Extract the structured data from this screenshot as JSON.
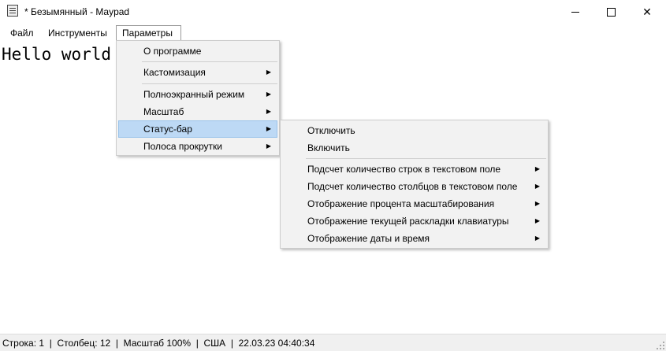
{
  "window": {
    "title": "* Безымянный - Maypad",
    "app_icon": "notepad-icon",
    "controls": [
      "minimize-icon",
      "maximize-icon",
      "close-icon"
    ]
  },
  "menubar": {
    "items": [
      {
        "label": "Файл"
      },
      {
        "label": "Инструменты"
      },
      {
        "label": "Параметры"
      }
    ]
  },
  "editor": {
    "content": "Hello world"
  },
  "params_menu": {
    "items": [
      {
        "label": "О программе"
      },
      {
        "label": "Кастомизация"
      },
      {
        "label": "Полноэкранный режим"
      },
      {
        "label": "Масштаб"
      },
      {
        "label": "Статус-бар"
      },
      {
        "label": "Полоса прокрутки"
      }
    ]
  },
  "statusbar_menu": {
    "items": [
      {
        "label": "Отключить"
      },
      {
        "label": "Включить"
      },
      {
        "label": "Подсчет количество строк в текстовом поле"
      },
      {
        "label": "Подсчет количество столбцов в текстовом поле"
      },
      {
        "label": "Отображение процента масштабирования"
      },
      {
        "label": "Отображение текущей раскладки клавиатуры"
      },
      {
        "label": "Отображение даты и время"
      }
    ]
  },
  "statusbar": {
    "text": "Строка: 1  |  Столбец: 12  |  Масштаб 100%  |  США  |  22.03.23 04:40:34"
  },
  "colors": {
    "highlight": "#bdd9f5",
    "menu_bg": "#f2f2f2",
    "status_bg": "#f0f0f0"
  }
}
